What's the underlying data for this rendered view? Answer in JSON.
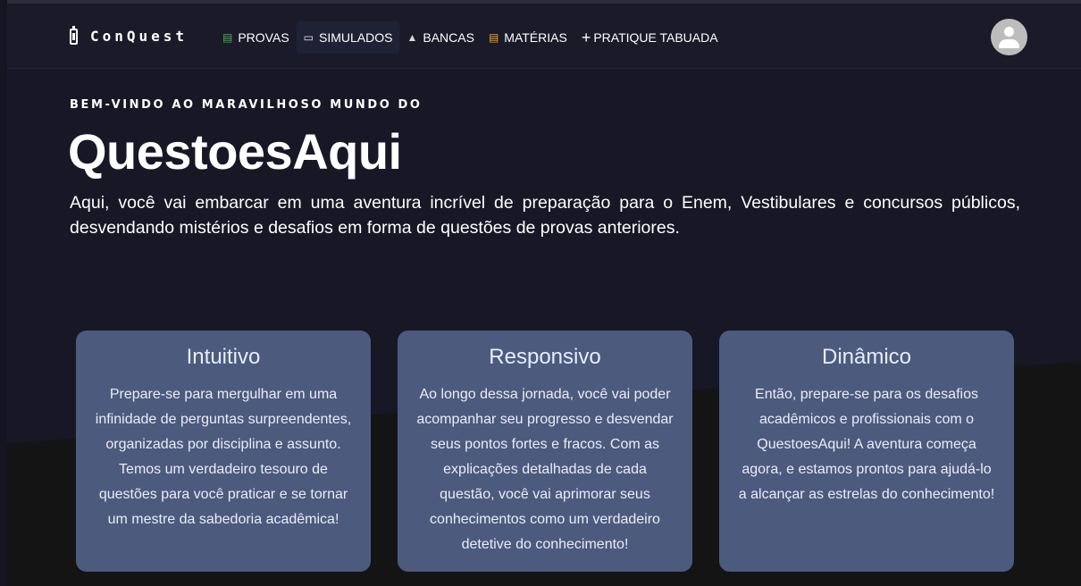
{
  "brand": {
    "name": "ConQuest",
    "icon": "battery-icon"
  },
  "nav": {
    "items": [
      {
        "label": "PROVAS",
        "icon": "books-icon"
      },
      {
        "label": "SIMULADOS",
        "icon": "document-icon"
      },
      {
        "label": "BANCAS",
        "icon": "bank-icon"
      },
      {
        "label": "MATÉRIAS",
        "icon": "books-stack-icon"
      },
      {
        "label": "PRATIQUE TABUADA",
        "icon": "plus-icon"
      }
    ],
    "active": "SIMULADOS"
  },
  "user": {
    "avatar_icon": "person-icon"
  },
  "hero": {
    "eyebrow": "BEM-VINDO AO MARAVILHOSO MUNDO DO",
    "title": "QuestoesAqui",
    "description": "Aqui, você vai embarcar em uma aventura incrível de preparação para o Enem, Vestibulares e concursos públicos, desvendando mistérios e desafios em forma de questões de provas anteriores."
  },
  "cards": [
    {
      "title": "Intuitivo",
      "text": "Prepare-se para mergulhar em uma infinidade de perguntas surpreendentes, organizadas por disciplina e assunto. Temos um verdadeiro tesouro de questões para você praticar e se tornar um mestre da sabedoria acadêmica!"
    },
    {
      "title": "Responsivo",
      "text": "Ao longo dessa jornada, você vai poder acompanhar seu progresso e desvendar seus pontos fortes e fracos. Com as explicações detalhadas de cada questão, você vai aprimorar seus conhecimentos como um verdadeiro detetive do conhecimento!"
    },
    {
      "title": "Dinâmico",
      "text": "Então, prepare-se para os desafios acadêmicos e profissionais com o QuestoesAqui! A aventura começa agora, e estamos prontos para ajudá-lo a alcançar as estrelas do conhecimento!"
    }
  ],
  "colors": {
    "navbar": "#1a1a29",
    "hero_bg": "#171726",
    "bottom_bg": "#141414",
    "card": "#4c5a7e",
    "text": "#ffffff"
  }
}
